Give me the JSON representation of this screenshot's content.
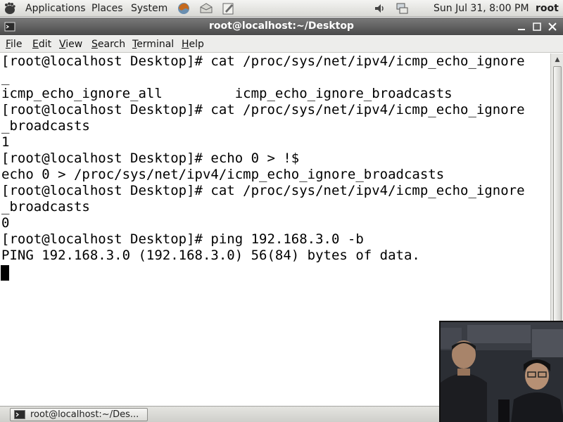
{
  "top_panel": {
    "menus": [
      "Applications",
      "Places",
      "System"
    ],
    "clock": "Sun Jul 31,  8:00 PM",
    "user": "root"
  },
  "window": {
    "title": "root@localhost:~/Desktop"
  },
  "menu_bar": [
    {
      "label": "File",
      "mnemonic": "F",
      "rest": "ile"
    },
    {
      "label": "Edit",
      "mnemonic": "E",
      "rest": "dit"
    },
    {
      "label": "View",
      "mnemonic": "V",
      "rest": "iew"
    },
    {
      "label": "Search",
      "mnemonic": "S",
      "rest": "earch"
    },
    {
      "label": "Terminal",
      "mnemonic": "T",
      "rest": "erminal"
    },
    {
      "label": "Help",
      "mnemonic": "H",
      "rest": "elp"
    }
  ],
  "terminal": {
    "lines": [
      "[root@localhost Desktop]# cat /proc/sys/net/ipv4/icmp_echo_ignore",
      "_",
      "icmp_echo_ignore_all         icmp_echo_ignore_broadcasts",
      "[root@localhost Desktop]# cat /proc/sys/net/ipv4/icmp_echo_ignore",
      "_broadcasts",
      "1",
      "[root@localhost Desktop]# echo 0 > !$",
      "echo 0 > /proc/sys/net/ipv4/icmp_echo_ignore_broadcasts",
      "[root@localhost Desktop]# cat /proc/sys/net/ipv4/icmp_echo_ignore",
      "_broadcasts",
      "0",
      "[root@localhost Desktop]# ping 192.168.3.0 -b",
      "PING 192.168.3.0 (192.168.3.0) 56(84) bytes of data."
    ]
  },
  "taskbar": {
    "window_button": "root@localhost:~/Des..."
  },
  "icons": {
    "distro_logo": "gnome-foot-icon",
    "browser": "firefox-icon",
    "mail": "mail-icon",
    "editor": "text-editor-icon",
    "volume": "speaker-icon",
    "network": "network-icon",
    "terminal": "terminal-icon"
  },
  "colors": {
    "title_bar": "#5a5a5a",
    "terminal_bg": "#ffffff",
    "terminal_fg": "#000000"
  }
}
